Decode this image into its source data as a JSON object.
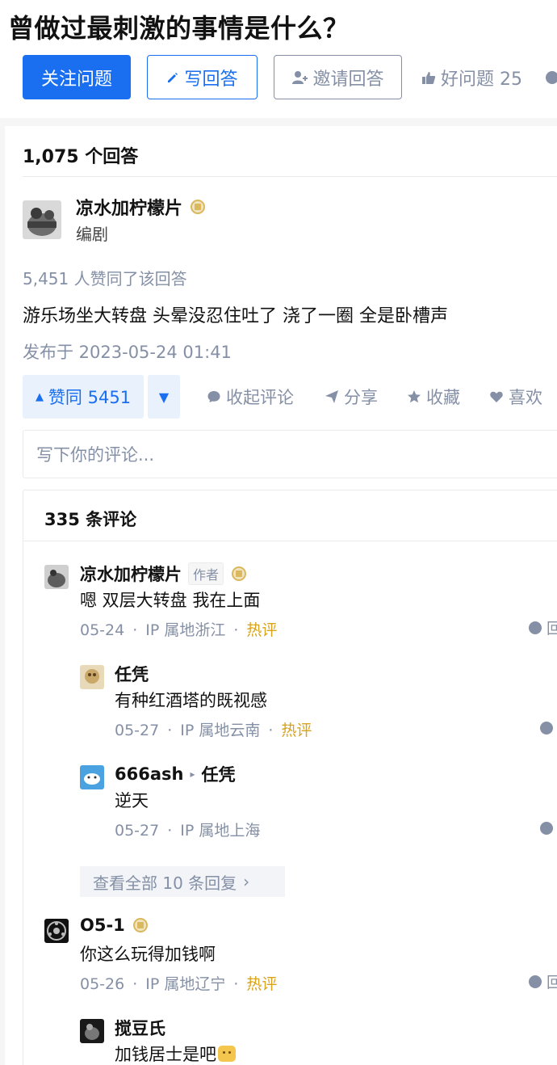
{
  "question": {
    "title": "曾做过最刺激的事情是什么？",
    "follow_label": "关注问题",
    "write_label": "写回答",
    "invite_label": "邀请回答",
    "good_question_label": "好问题 25"
  },
  "answers_count": "1,075 个回答",
  "answer": {
    "author_name": "凉水加柠檬片",
    "author_role": "编剧",
    "vote_summary": "5,451 人赞同了该回答",
    "text": "游乐场坐大转盘 头晕没忍住吐了 浇了一圈 全是卧槽声",
    "publish_time": "发布于 2023-05-24 01:41",
    "upvote_label": "赞同 5451",
    "actions": {
      "collapse_comments": "收起评论",
      "share": "分享",
      "favorite": "收藏",
      "like": "喜欢"
    }
  },
  "comment_input": {
    "placeholder": "写下你的评论..."
  },
  "comments": {
    "count_label": "335 条评论",
    "items": [
      {
        "name": "凉水加柠檬片",
        "author_tag": "作者",
        "text": "嗯 双层大转盘 我在上面",
        "date": "05-24",
        "ip": "IP 属地浙江",
        "hot": "热评",
        "replies": [
          {
            "name": "任凭",
            "text": "有种红酒塔的既视感",
            "date": "05-27",
            "ip": "IP 属地云南",
            "hot": "热评"
          },
          {
            "name": "666ash",
            "reply_to": "任凭",
            "text": "逆天",
            "date": "05-27",
            "ip": "IP 属地上海"
          }
        ],
        "view_all_label": "查看全部 10 条回复"
      },
      {
        "name": "O5-1",
        "text": "你这么玩得加钱啊",
        "date": "05-26",
        "ip": "IP 属地辽宁",
        "hot": "热评",
        "replies": [
          {
            "name": "搅豆氏",
            "text": "加钱居士是吧"
          }
        ]
      }
    ]
  },
  "colors": {
    "primary": "#1a6ff0",
    "muted": "#8590a6",
    "hot": "#d9a21b"
  }
}
